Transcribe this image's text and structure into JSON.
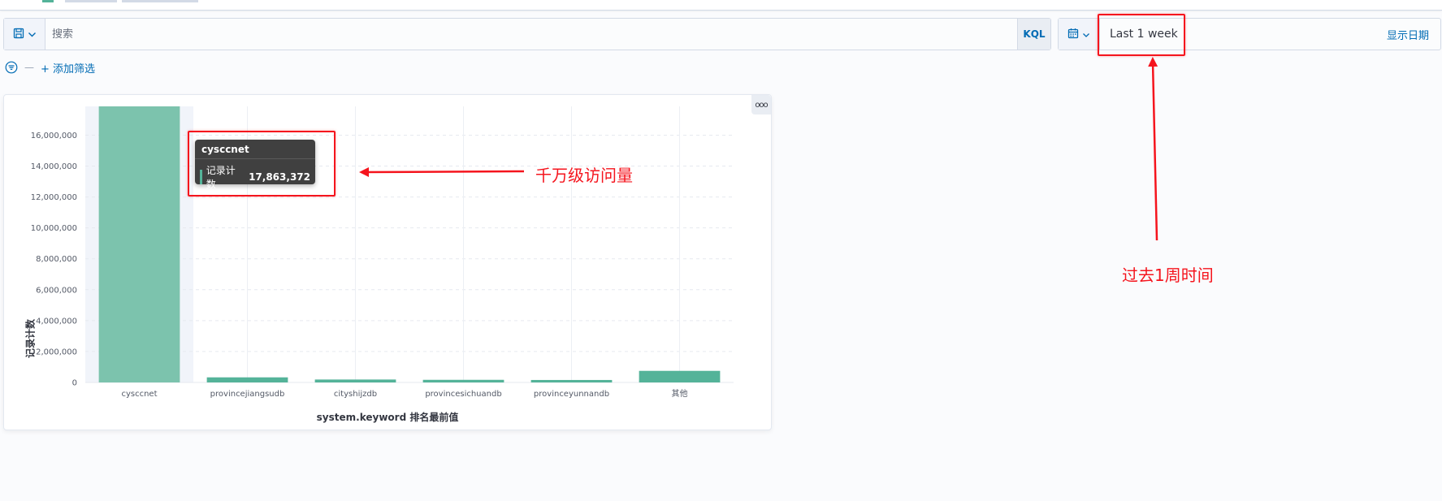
{
  "search": {
    "placeholder": "搜索",
    "language_label": "KQL"
  },
  "date_picker": {
    "value": "Last 1 week",
    "show_dates_label": "显示日期"
  },
  "filters": {
    "separator": "—",
    "add_filter_label": "+ 添加筛选"
  },
  "panel": {
    "menu_label": "ooo"
  },
  "tooltip": {
    "title": "cysccnet",
    "metric_label": "记录计数",
    "metric_value": "17,863,372"
  },
  "annotations": {
    "note_visits": "千万级访问量",
    "note_time": "过去1周时间"
  },
  "colors": {
    "bar": "#54b399",
    "bar_highlight": "#7cc3ad",
    "annotation": "#f5141d",
    "link": "#006bb4"
  },
  "chart_data": {
    "type": "bar",
    "title": "",
    "xlabel": "system.keyword 排名最前值",
    "ylabel": "记录计数",
    "categories": [
      "cysccnet",
      "provincejiangsudb",
      "cityshijzdb",
      "provincesichuandb",
      "provinceyunnandb",
      "其他"
    ],
    "values": [
      17863372,
      330000,
      190000,
      170000,
      160000,
      750000
    ],
    "ylim": [
      0,
      17863372
    ],
    "yticks": [
      0,
      2000000,
      4000000,
      6000000,
      8000000,
      10000000,
      12000000,
      14000000,
      16000000
    ],
    "ytick_labels": [
      "0",
      "2,000,000",
      "4,000,000",
      "6,000,000",
      "8,000,000",
      "10,000,000",
      "12,000,000",
      "14,000,000",
      "16,000,000"
    ],
    "highlighted_category": "cysccnet",
    "grid": true,
    "legend": "none"
  }
}
